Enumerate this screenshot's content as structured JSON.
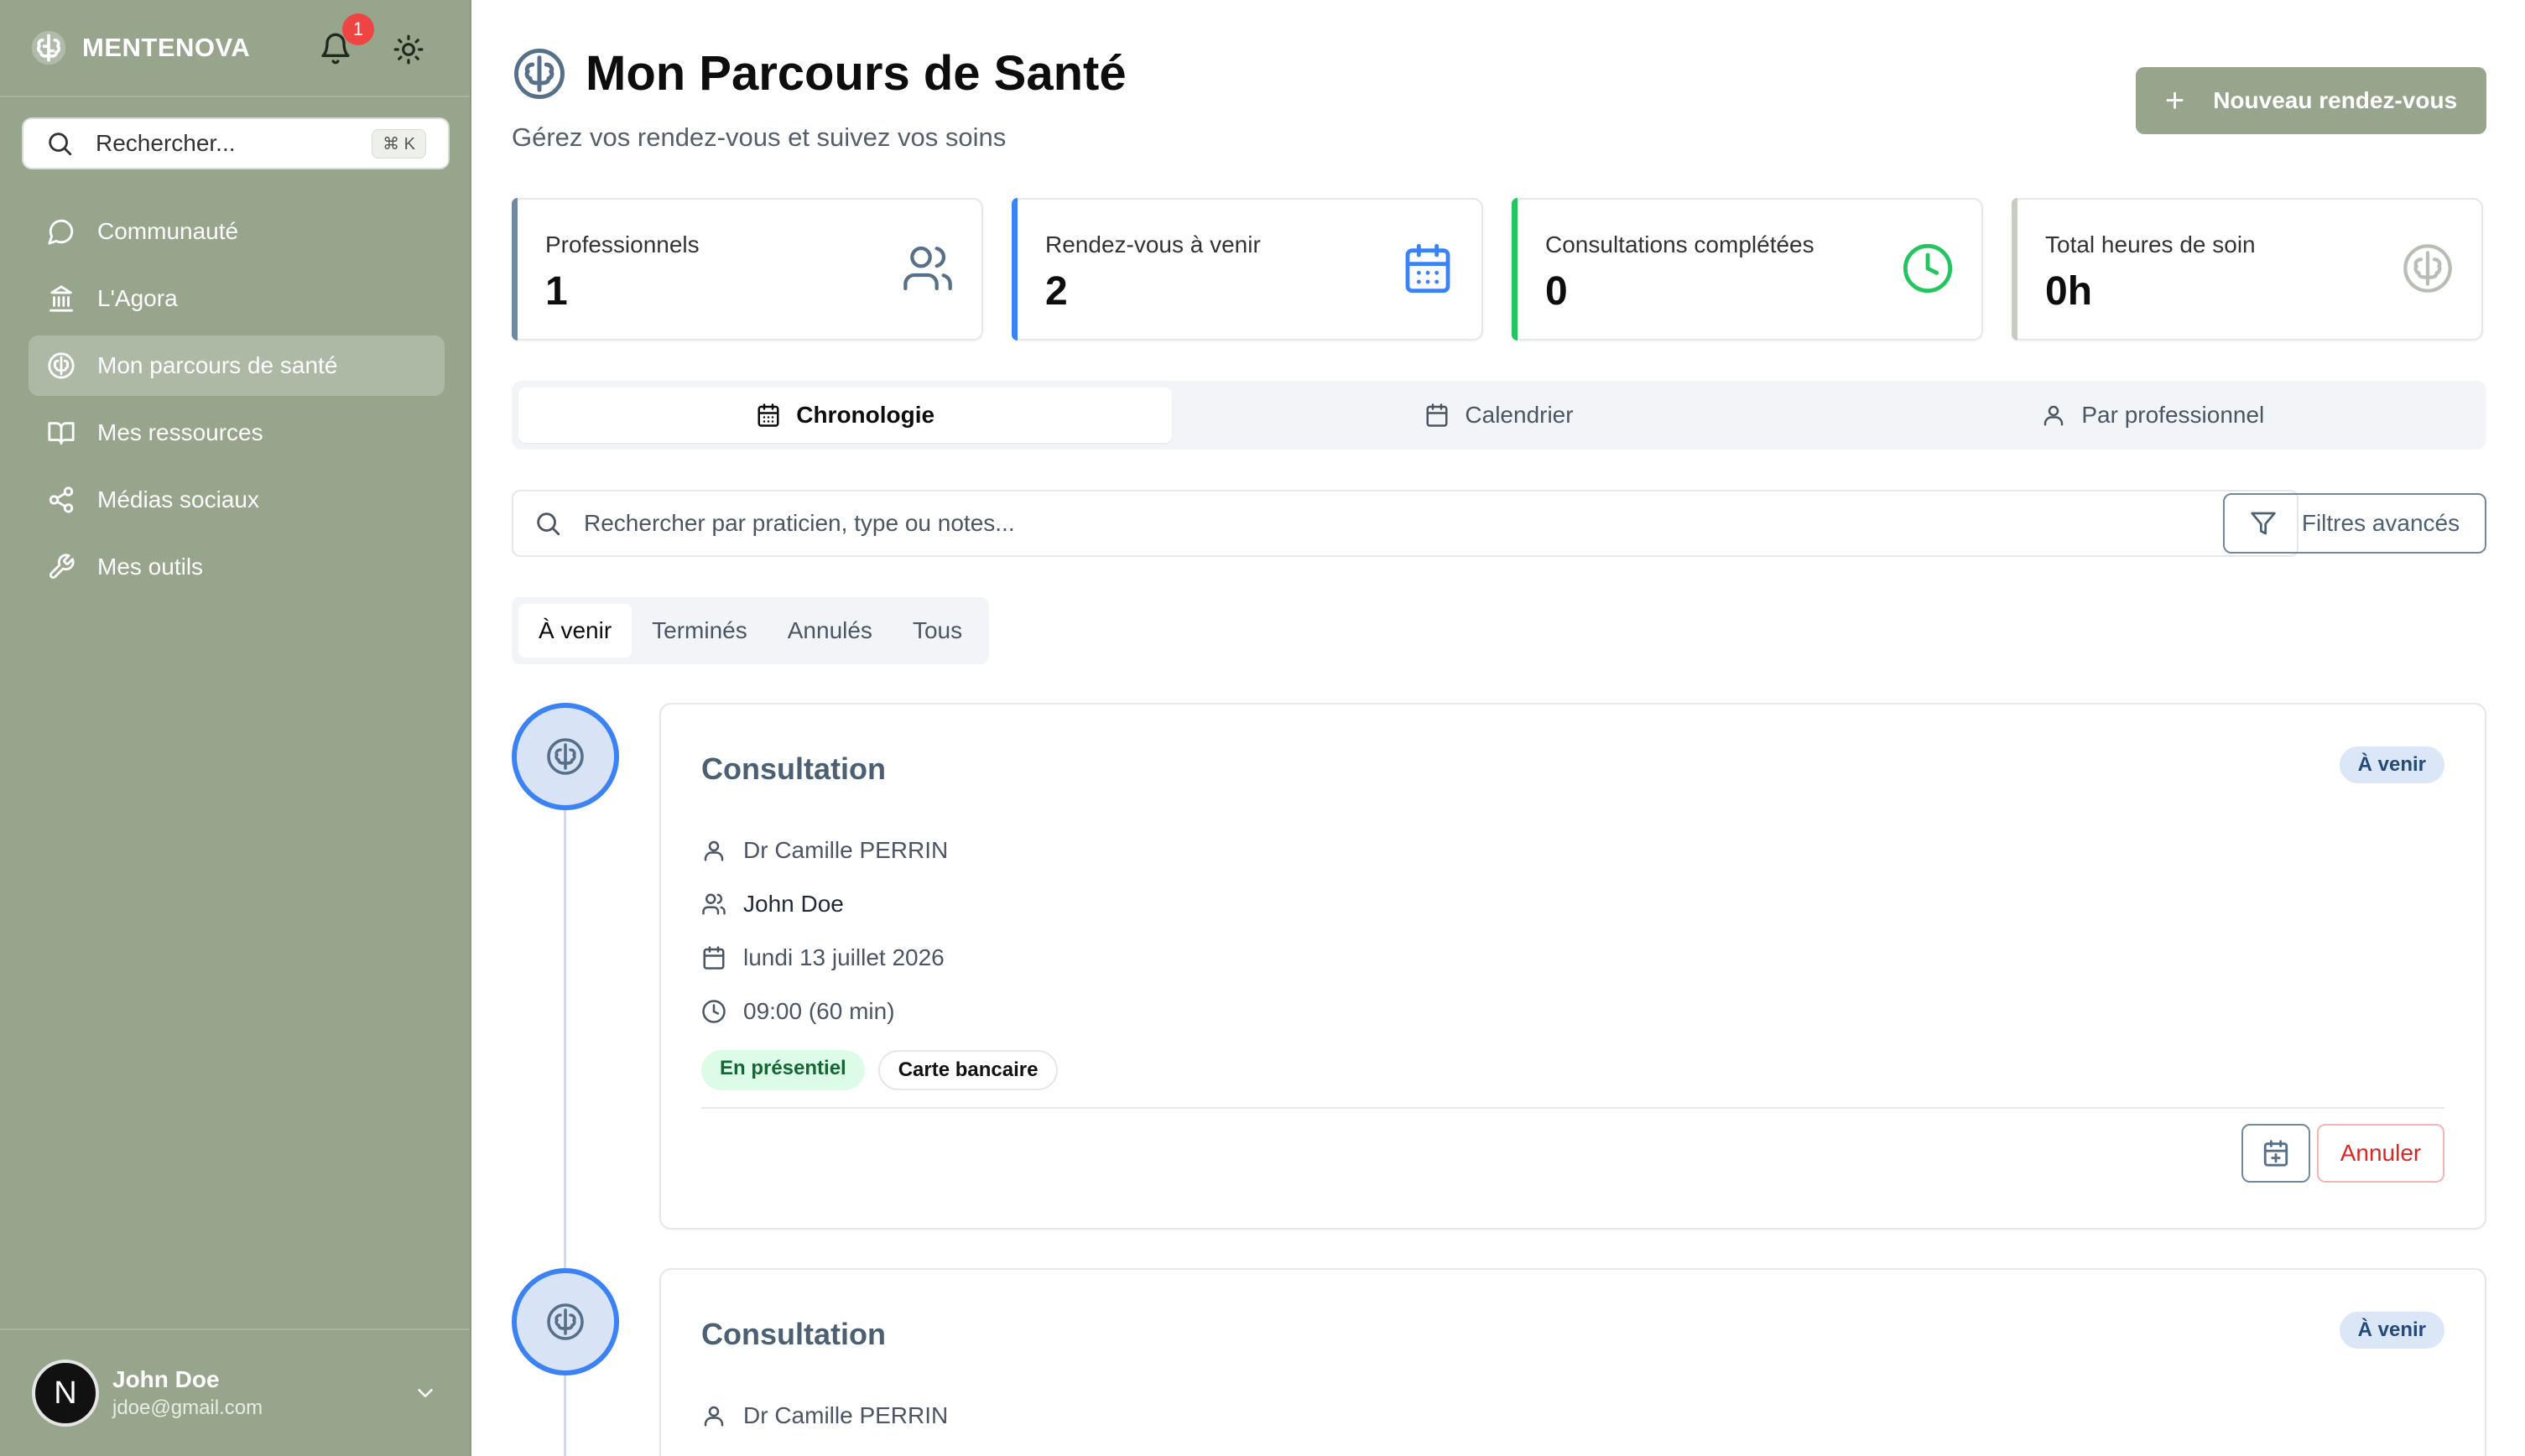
{
  "app": {
    "name": "MENTENOVA",
    "notifications": "1"
  },
  "sidebar": {
    "search_placeholder": "Rechercher...",
    "search_shortcut": "⌘ K",
    "items": [
      {
        "label": "Communauté",
        "icon": "message-circle-icon"
      },
      {
        "label": "L'Agora",
        "icon": "landmark-icon"
      },
      {
        "label": "Mon parcours de santé",
        "icon": "brain-icon",
        "active": true
      },
      {
        "label": "Mes ressources",
        "icon": "book-open-icon"
      },
      {
        "label": "Médias sociaux",
        "icon": "share-icon"
      },
      {
        "label": "Mes outils",
        "icon": "wrench-icon"
      }
    ]
  },
  "user": {
    "initial": "N",
    "name": "John Doe",
    "email": "jdoe@gmail.com"
  },
  "header": {
    "title": "Mon Parcours de Santé",
    "subtitle": "Gérez vos rendez-vous et suivez vos soins",
    "new_button": "Nouveau rendez-vous"
  },
  "stats": [
    {
      "label": "Professionnels",
      "value": "1",
      "icon": "users-icon"
    },
    {
      "label": "Rendez-vous à venir",
      "value": "2",
      "icon": "calendar-icon"
    },
    {
      "label": "Consultations complétées",
      "value": "0",
      "icon": "clock-icon"
    },
    {
      "label": "Total heures de soin",
      "value": "0h",
      "icon": "brain-icon"
    }
  ],
  "views": [
    {
      "label": "Chronologie",
      "active": true
    },
    {
      "label": "Calendrier"
    },
    {
      "label": "Par professionnel"
    }
  ],
  "search": {
    "placeholder": "Rechercher par praticien, type ou notes...",
    "filters_button": "Filtres avancés"
  },
  "status_tabs": [
    {
      "label": "À venir",
      "active": true
    },
    {
      "label": "Terminés"
    },
    {
      "label": "Annulés"
    },
    {
      "label": "Tous"
    }
  ],
  "appointments": [
    {
      "type": "Consultation",
      "status": "À venir",
      "practitioner": "Dr Camille PERRIN",
      "patient": "John Doe",
      "date": "lundi 13 juillet 2026",
      "time": "09:00 (60 min)",
      "tags": [
        "En présentiel",
        "Carte bancaire"
      ],
      "cancel_label": "Annuler"
    },
    {
      "type": "Consultation",
      "status": "À venir",
      "practitioner": "Dr Camille PERRIN"
    }
  ],
  "colors": {
    "sidebar": "#97a58c",
    "accent_blue": "#3b82f6",
    "accent_green": "#22c55e",
    "slate": "#56708a",
    "danger": "#dc2626"
  }
}
